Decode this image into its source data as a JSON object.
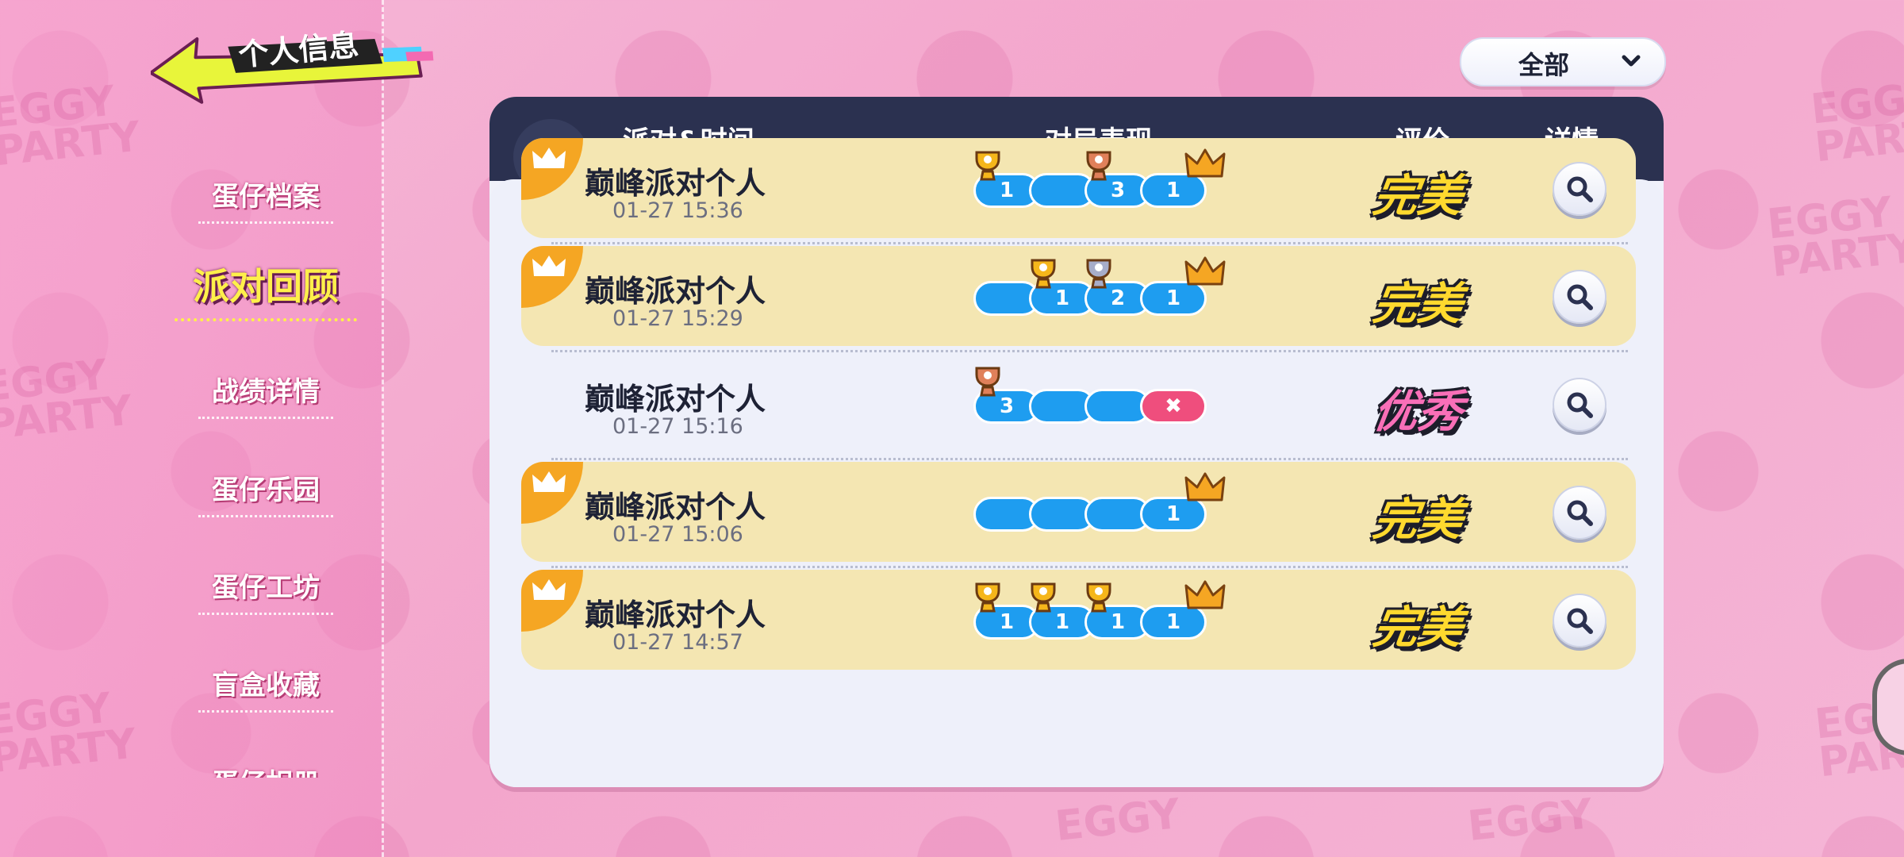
{
  "header": {
    "title": "个人信息"
  },
  "sidebar": {
    "items": [
      {
        "label": "蛋仔档案"
      },
      {
        "label": "派对回顾",
        "active": true
      },
      {
        "label": "战绩详情"
      },
      {
        "label": "蛋仔乐园"
      },
      {
        "label": "蛋仔工坊"
      },
      {
        "label": "盲盒收藏"
      },
      {
        "label": "蛋仔相册"
      }
    ]
  },
  "filter": {
    "selected": "全部"
  },
  "table": {
    "columns": [
      "派对&时间",
      "对局表现",
      "评价",
      "详情"
    ],
    "rows": [
      {
        "name": "巅峰派对个人",
        "time": "01-27 15:36",
        "win": true,
        "rating": "完美",
        "rounds": [
          {
            "rank": "1",
            "trophy": "gold"
          },
          {
            "rank": "",
            "trophy": ""
          },
          {
            "rank": "3",
            "trophy": "bronze"
          },
          {
            "rank": "1",
            "trophy": "crown"
          }
        ]
      },
      {
        "name": "巅峰派对个人",
        "time": "01-27 15:29",
        "win": true,
        "rating": "完美",
        "rounds": [
          {
            "rank": "",
            "trophy": ""
          },
          {
            "rank": "1",
            "trophy": "gold"
          },
          {
            "rank": "2",
            "trophy": "silver"
          },
          {
            "rank": "1",
            "trophy": "crown"
          }
        ]
      },
      {
        "name": "巅峰派对个人",
        "time": "01-27 15:16",
        "win": false,
        "rating": "优秀",
        "rounds": [
          {
            "rank": "3",
            "trophy": "bronze"
          },
          {
            "rank": "",
            "trophy": ""
          },
          {
            "rank": "",
            "trophy": ""
          },
          {
            "rank": "✖",
            "trophy": "",
            "lose": true
          }
        ]
      },
      {
        "name": "巅峰派对个人",
        "time": "01-27 15:06",
        "win": true,
        "rating": "完美",
        "rounds": [
          {
            "rank": "",
            "trophy": ""
          },
          {
            "rank": "",
            "trophy": ""
          },
          {
            "rank": "",
            "trophy": ""
          },
          {
            "rank": "1",
            "trophy": "crown"
          }
        ]
      },
      {
        "name": "巅峰派对个人",
        "time": "01-27 14:57",
        "win": true,
        "rating": "完美",
        "rounds": [
          {
            "rank": "1",
            "trophy": "gold"
          },
          {
            "rank": "1",
            "trophy": "gold"
          },
          {
            "rank": "1",
            "trophy": "gold"
          },
          {
            "rank": "1",
            "trophy": "crown"
          }
        ]
      }
    ]
  },
  "colors": {
    "accent_yellow": "#fff04a",
    "win_row": "#f4e6b2",
    "pill_blue": "#1e9df0",
    "lose_pink": "#ef4e7d",
    "header_navy": "#2b3150"
  },
  "icons": {
    "back": "arrow-left-icon",
    "crown": "crown-icon",
    "trophy": "trophy-icon",
    "search": "search-icon",
    "chevron": "chevron-down-icon"
  }
}
